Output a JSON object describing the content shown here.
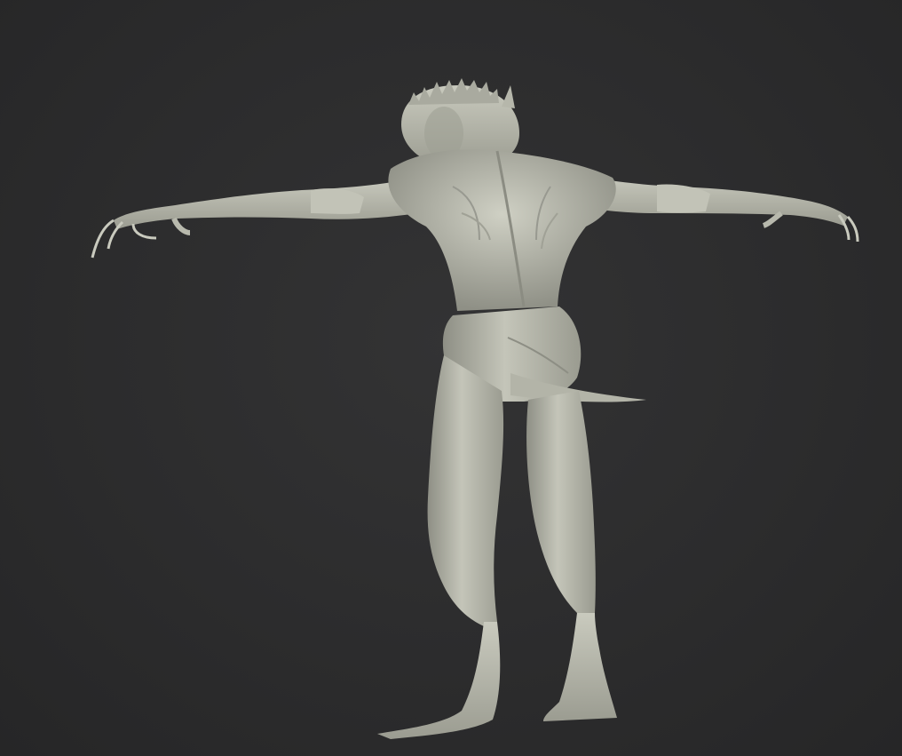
{
  "viewport": {
    "background_color": "#2b2b2c",
    "model": {
      "subject": "creature-sculpt-back-view",
      "material_color": "#b8b9ad",
      "shadow_color": "#6f7067",
      "highlight_color": "#dcddd2"
    }
  }
}
